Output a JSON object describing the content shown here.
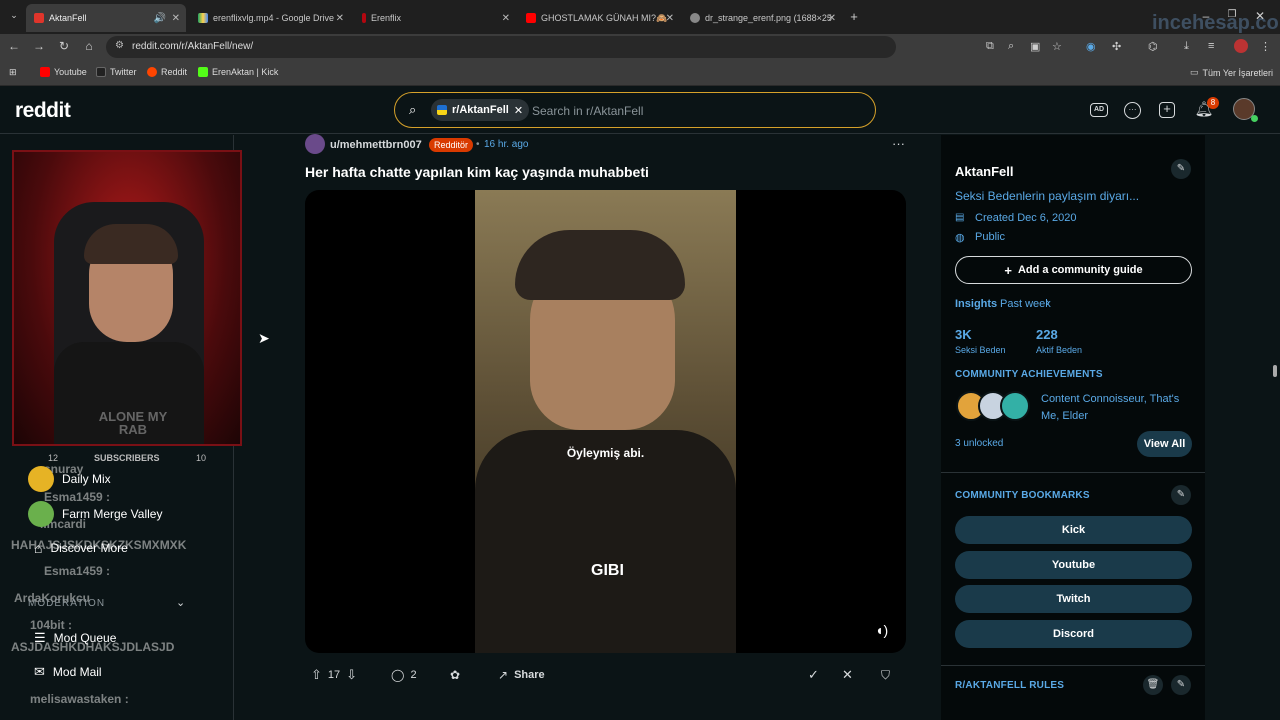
{
  "browser": {
    "tabs": [
      {
        "title": "AktanFell",
        "active": true
      },
      {
        "title": "erenflixvlg.mp4 - Google Drive",
        "active": false
      },
      {
        "title": "Erenflix",
        "active": false
      },
      {
        "title": "GHOSTLAMAK GÜNAH MI?🙈",
        "active": false
      },
      {
        "title": "dr_strange_erenf.png (1688×25",
        "active": false
      }
    ],
    "url": "reddit.com/r/AktanFell/new/",
    "bookmarks": [
      "Youtube",
      "Twitter",
      "Reddit",
      "ErenAktan | Kick"
    ],
    "all_bookmarks": "Tüm Yer İşaretleri",
    "watermark": "incehesap.com"
  },
  "header": {
    "logo": "reddit",
    "search_chip": "r/AktanFell",
    "search_placeholder": "Search in r/AktanFell",
    "notification_count": "8"
  },
  "stream_overlay": {
    "subscribers_label": "SUBSCRIBERS",
    "subscribers_left": "12",
    "subscribers_right": "10",
    "shirt_text": "ALONE MY RAB",
    "chat": [
      {
        "user": "snuray"
      },
      {
        "user": "Esma1459 :"
      },
      {
        "user": "limcardi"
      },
      {
        "user": "HAHAJSJSKDKSKZKSMXMXK"
      },
      {
        "user": "Esma1459 :"
      },
      {
        "user": "ArdaKorukcu"
      },
      {
        "user": "104bit :"
      },
      {
        "user": "ASJDASHKDHAKSJDLASJD"
      },
      {
        "user": "melisawastaken :"
      }
    ]
  },
  "leftbar": {
    "items": [
      {
        "label": "Daily Mix"
      },
      {
        "label": "Farm Merge Valley"
      },
      {
        "label": "Discover More"
      }
    ],
    "moderation_heading": "MODERATION",
    "mod_items": [
      {
        "label": "Mod Queue"
      },
      {
        "label": "Mod Mail"
      }
    ]
  },
  "post": {
    "author": "u/mehmettbrn007",
    "flair": "Redditör",
    "time": "16 hr. ago",
    "title": "Her hafta chatte yapılan kim kaç yaşında muhabbeti",
    "subtitle": "Öyleymiş abi.",
    "video_watermark": "GIBI",
    "votes": "17",
    "comments": "2",
    "share": "Share"
  },
  "sidebar": {
    "name": "AktanFell",
    "description": "Seksi Bedenlerin paylaşım diyarı...",
    "created": "Created Dec 6, 2020",
    "visibility": "Public",
    "guide_button": "Add a community guide",
    "insights_label": "Insights",
    "insights_period": "Past week",
    "stats": [
      {
        "value": "3K",
        "label": "Seksi Beden"
      },
      {
        "value": "228",
        "label": "Aktif Beden"
      }
    ],
    "achievements_title": "COMMUNITY ACHIEVEMENTS",
    "achievements_text": "Content Connoisseur, That's Me, Elder",
    "unlocked": "3 unlocked",
    "view_all": "View All",
    "bookmarks_title": "COMMUNITY BOOKMARKS",
    "bookmarks": [
      "Kick",
      "Youtube",
      "Twitch",
      "Discord"
    ],
    "rules_title": "R/AKTANFELL RULES"
  },
  "colors": {
    "accent_blue": "#5aa9e6",
    "flair_orange": "#d93a00",
    "search_border": "#d6a12a",
    "background": "#0b1416"
  }
}
